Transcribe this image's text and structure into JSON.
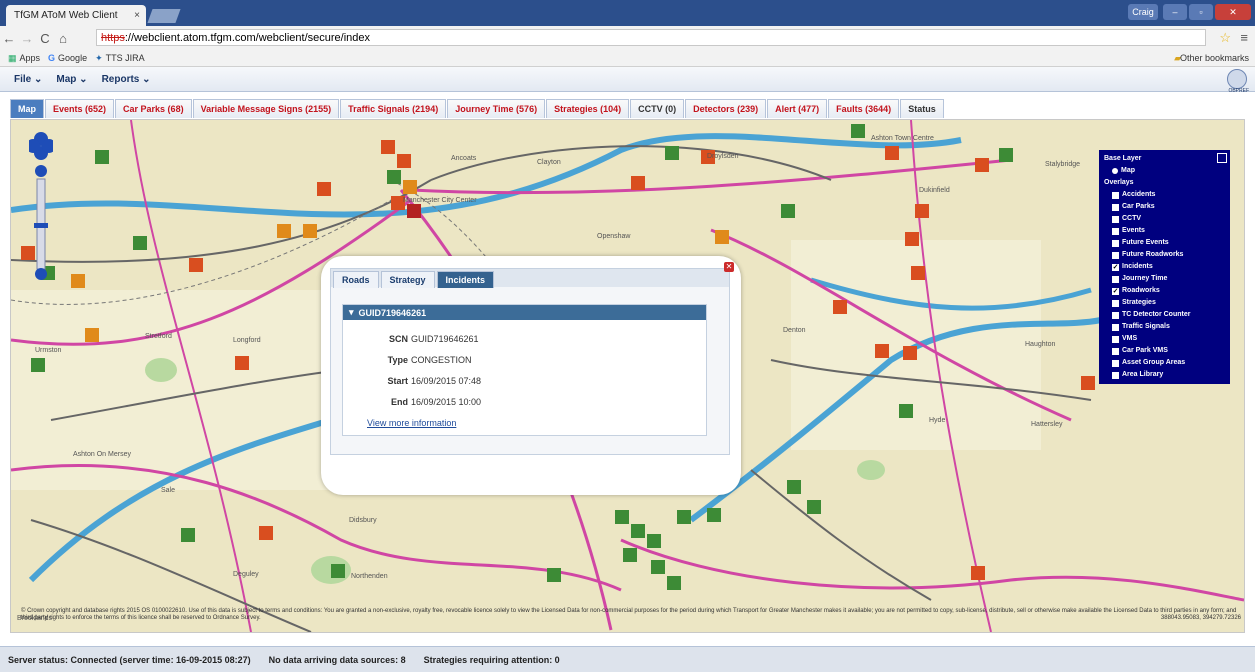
{
  "browser": {
    "tab_title": "TfGM AToM Web Client",
    "tab_close": "×",
    "url_scheme": "https",
    "url_rest": "://webclient.atom.tfgm.com/webclient/secure/index",
    "bookmarks": [
      "Apps",
      "Google",
      "TTS JIRA"
    ],
    "other_bookmarks": "Other bookmarks",
    "user_badge": "Craig"
  },
  "menubar": {
    "items": [
      "File ⌄",
      "Map ⌄",
      "Reports ⌄"
    ],
    "gear_label": "OBPREF"
  },
  "tabs": [
    "Map",
    "Events (652)",
    "Car Parks (68)",
    "Variable Message Signs (2155)",
    "Traffic Signals (2194)",
    "Journey Time (576)",
    "Strategies (104)",
    "CCTV (0)",
    "Detectors (239)",
    "Alert (477)",
    "Faults (3644)",
    "Status"
  ],
  "layers": {
    "base_title": "Base Layer",
    "base_item": "Map",
    "overlays_title": "Overlays",
    "items": [
      {
        "label": "Accidents",
        "checked": false
      },
      {
        "label": "Car Parks",
        "checked": false
      },
      {
        "label": "CCTV",
        "checked": false
      },
      {
        "label": "Events",
        "checked": false
      },
      {
        "label": "Future Events",
        "checked": false
      },
      {
        "label": "Future Roadworks",
        "checked": false
      },
      {
        "label": "Incidents",
        "checked": true
      },
      {
        "label": "Journey Time",
        "checked": false
      },
      {
        "label": "Roadworks",
        "checked": true
      },
      {
        "label": "Strategies",
        "checked": false
      },
      {
        "label": "TC Detector Counter",
        "checked": false
      },
      {
        "label": "Traffic Signals",
        "checked": false
      },
      {
        "label": "VMS",
        "checked": false
      },
      {
        "label": "Car Park VMS",
        "checked": false
      },
      {
        "label": "Asset Group Areas",
        "checked": false
      },
      {
        "label": "Area Library",
        "checked": false
      }
    ]
  },
  "popup": {
    "tabs": [
      "Roads",
      "Strategy",
      "Incidents"
    ],
    "header": "GUID719646261",
    "fields": [
      {
        "key": "SCN",
        "value": "GUID719646261"
      },
      {
        "key": "Type",
        "value": "CONGESTION"
      },
      {
        "key": "Start",
        "value": "16/09/2015 07:48"
      },
      {
        "key": "End",
        "value": "16/09/2015 10:00"
      }
    ],
    "more_link": "View more information"
  },
  "map_labels": {
    "places": [
      "Ancoats",
      "Clayton",
      "Openshaw",
      "Droylsden",
      "Ashton Town Centre",
      "Stalybridge",
      "Dukinfield",
      "Denton",
      "Haughton",
      "Hyde",
      "Hattersley",
      "Stretford",
      "Longford",
      "Urmston",
      "Sale",
      "Didsbury",
      "Ashton On Mersey",
      "Brooklands",
      "Deguley",
      "Northenden",
      "Manchester City Center"
    ],
    "copyright": "© Crown copyright and database rights 2015 OS 0100022610. Use of this data is subject to terms and conditions: You are granted a non-exclusive, royalty free, revocable licence solely to view the Licensed Data for non-commercial purposes for the period during which Transport for Greater Manchester makes it available; you are not permitted to copy, sub-license, distribute, sell or otherwise make available the Licensed Data to third parties in any form; and third party rights to enforce the terms of this licence shall be reserved to Ordnance Survey.",
    "coords": "388043.95083, 394279.72326"
  },
  "status": {
    "server": "Server status: Connected (server time: 16-09-2015 08:27)",
    "sources": "No data arriving data sources: 8",
    "strategies": "Strategies requiring attention: 0"
  }
}
